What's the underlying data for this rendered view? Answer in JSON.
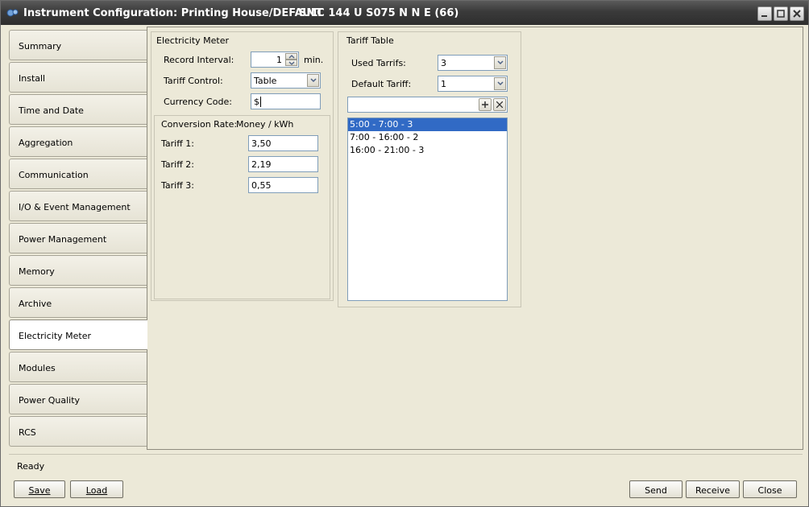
{
  "window": {
    "title": "Instrument Configuration: Printing House/DEFAULT",
    "device": "SMC 144 U S075 N N E (66)"
  },
  "tabs": [
    {
      "label": "Summary"
    },
    {
      "label": "Install"
    },
    {
      "label": "Time and Date"
    },
    {
      "label": "Aggregation"
    },
    {
      "label": "Communication"
    },
    {
      "label": "I/O & Event Management"
    },
    {
      "label": "Power Management"
    },
    {
      "label": "Memory"
    },
    {
      "label": "Archive"
    },
    {
      "label": "Electricity Meter"
    },
    {
      "label": "Modules"
    },
    {
      "label": "Power Quality"
    },
    {
      "label": "RCS"
    }
  ],
  "active_tab": "Electricity Meter",
  "electricity_meter": {
    "group_title": "Electricity Meter",
    "record_interval_label": "Record Interval:",
    "record_interval_value": "1",
    "record_interval_unit": "min.",
    "tariff_control_label": "Tariff Control:",
    "tariff_control_value": "Table",
    "currency_code_label": "Currency Code:",
    "currency_code_value": "$",
    "conversion_rate_label": "Conversion Rate:",
    "conversion_rate_unit": "Money / kWh",
    "tariffs": [
      {
        "label": "Tariff 1:",
        "value": "3,50"
      },
      {
        "label": "Tariff 2:",
        "value": "2,19"
      },
      {
        "label": "Tariff 3:",
        "value": "0,55"
      }
    ]
  },
  "tariff_table": {
    "group_title": "Tariff Table",
    "used_tariffs_label": "Used Tarrifs:",
    "used_tariffs_value": "3",
    "default_tariff_label": "Default Tariff:",
    "default_tariff_value": "1",
    "new_entry_value": "",
    "entries": [
      "5:00 - 7:00 - 3",
      "7:00 - 16:00 - 2",
      "16:00 - 21:00 - 3"
    ],
    "selected_entry": "5:00 - 7:00 - 3"
  },
  "status": {
    "text": "Ready"
  },
  "buttons": {
    "save": "Save",
    "load": "Load",
    "send": "Send",
    "receive": "Receive",
    "close": "Close"
  },
  "icons": {
    "app": "gears-icon",
    "minimize": "minimize-icon",
    "maximize": "maximize-icon",
    "close": "close-icon",
    "add": "plus-icon",
    "remove": "x-icon",
    "dropdown": "chevron-down-icon",
    "spin": "spinner-arrows-icon"
  },
  "colors": {
    "titlebar": "#3a3a3a",
    "selection": "#316ac5",
    "window_bg": "#ece9d8"
  }
}
